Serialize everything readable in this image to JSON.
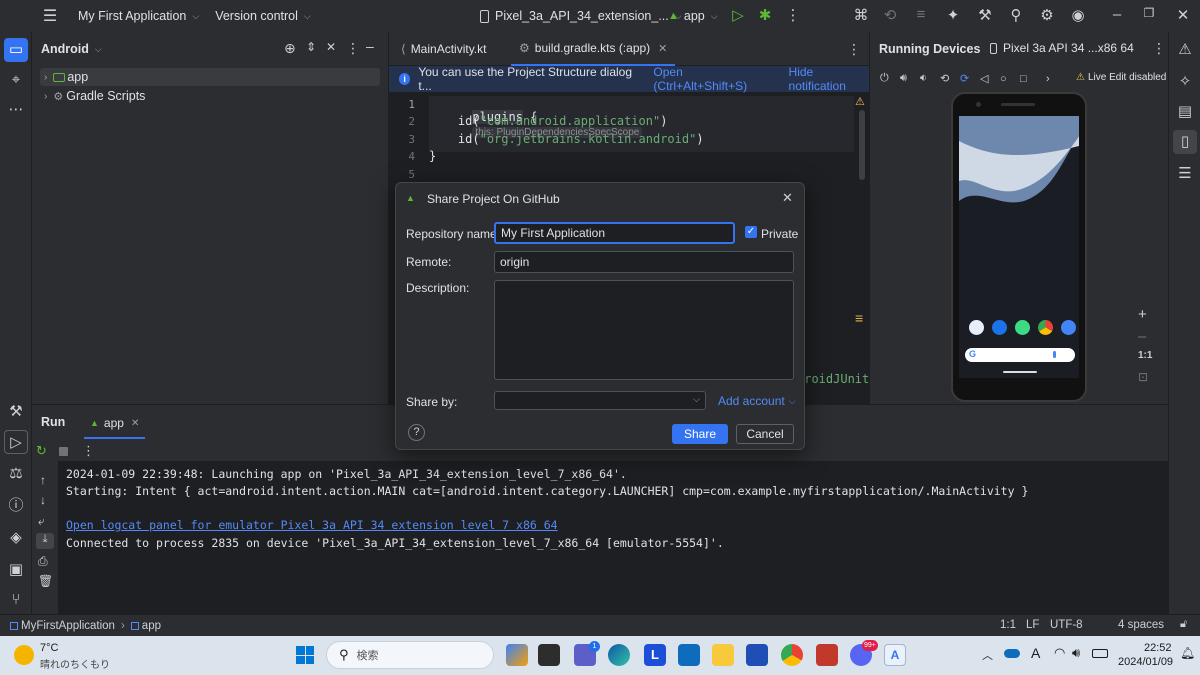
{
  "titlebar": {
    "project_name": "My First Application",
    "vcs_label": "Version control",
    "device_selector": "Pixel_3a_API_34_extension_...",
    "run_config": "app"
  },
  "project_panel": {
    "title": "Android",
    "items": [
      {
        "label": "app"
      },
      {
        "label": "Gradle Scripts"
      }
    ]
  },
  "editor": {
    "tabs": [
      {
        "label": "MainActivity.kt"
      },
      {
        "label": "build.gradle.kts (:app)"
      }
    ],
    "notification": {
      "text": "You can use the Project Structure dialog t...",
      "open_link": "Open (Ctrl+Alt+Shift+S)",
      "hide_link": "Hide notification"
    },
    "line_numbers": [
      "1",
      "2",
      "3",
      "4",
      "5"
    ],
    "code": {
      "line1_keyword": "plugins",
      "line1_brace": "{",
      "hint": "this: PluginDependenciesSpecScope",
      "line2_fn": "id(",
      "line2_str": "\"com.android.application\"",
      "line2_end": ")",
      "line3_fn": "id(",
      "line3_str": "\"org.jetbrains.kotlin.android\"",
      "line3_end": ")",
      "line4": "}",
      "tail_fragment": "droidJUnitR"
    }
  },
  "devices": {
    "panel_title": "Running Devices",
    "device_tab": "Pixel 3a API 34 ...x86 64",
    "live_edit": "Live Edit disabled",
    "zoom_label": "1:1"
  },
  "run_panel": {
    "tab_run": "Run",
    "tab_app": "app",
    "lines": [
      "2024-01-09 22:39:48: Launching app on 'Pixel_3a_API_34_extension_level_7_x86_64'.",
      "Starting: Intent { act=android.intent.action.MAIN cat=[android.intent.category.LAUNCHER] cmp=com.example.myfirstapplication/.MainActivity }",
      "Open logcat panel for emulator Pixel 3a API 34 extension level 7 x86 64",
      "Connected to process 2835 on device 'Pixel_3a_API_34_extension_level_7_x86_64 [emulator-5554]'."
    ]
  },
  "statusbar": {
    "breadcrumb_project": "MyFirstApplication",
    "breadcrumb_module": "app",
    "position": "1:1",
    "line_sep": "LF",
    "encoding": "UTF-8",
    "indent": "4 spaces"
  },
  "dialog": {
    "title": "Share Project On GitHub",
    "repo_label": "Repository name:",
    "repo_value": "My First Application",
    "private_label": "Private",
    "private_checked": true,
    "remote_label": "Remote:",
    "remote_value": "origin",
    "description_label": "Description:",
    "description_value": "",
    "share_by_label": "Share by:",
    "share_by_value": "",
    "add_account": "Add account",
    "share_button": "Share",
    "cancel_button": "Cancel",
    "help": "?"
  },
  "taskbar": {
    "weather_temp": "7°C",
    "weather_desc": "晴れのちくもり",
    "search_placeholder": "検索",
    "ime_a": "A",
    "time": "22:52",
    "date": "2024/01/09",
    "badge_count_1": "1",
    "badge_count_2": "99+"
  },
  "colors": {
    "accent": "#3574f0",
    "panel": "#2b2d30",
    "editor_bg": "#1e1f22",
    "string": "#6aab73",
    "link": "#548af7"
  }
}
